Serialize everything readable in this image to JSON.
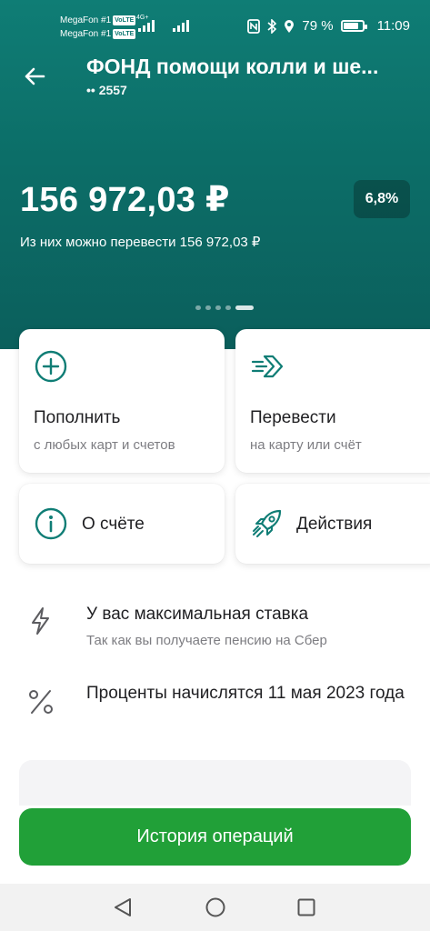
{
  "status_bar": {
    "sim1": "MegaFon #1",
    "sim2": "MegaFon #1",
    "volte": "VoLTE",
    "net_type": "4G+",
    "battery_percent": "79 %",
    "battery_level": 0.79,
    "time": "11:09"
  },
  "header": {
    "title": "ФОНД помощи колли и ше...",
    "account_mask": "•• 2557",
    "balance": "156 972,03 ₽",
    "rate_badge": "6,8%",
    "available_text": "Из них можно перевести 156 972,03 ₽",
    "pager": {
      "count": 5,
      "active_index": 4
    }
  },
  "actions": {
    "top_up": {
      "label": "Пополнить",
      "sub": "с любых карт и счетов",
      "icon": "plus-circle-icon"
    },
    "transfer": {
      "label": "Перевести",
      "sub": "на карту или счёт",
      "icon": "send-arrow-icon"
    },
    "about": {
      "label": "О счёте",
      "icon": "info-circle-icon"
    },
    "actions_menu": {
      "label": "Действия",
      "icon": "rocket-icon"
    }
  },
  "info_rows": {
    "rate": {
      "title": "У вас максимальная ставка",
      "subtitle": "Так как вы получаете пенсию на Сбер",
      "icon": "lightning-icon"
    },
    "interest": {
      "title": "Проценты начислятся 11 мая 2023 года",
      "icon": "percent-icon"
    }
  },
  "bottom": {
    "history_button": "История операций"
  },
  "colors": {
    "header_teal": "#0c6e68",
    "accent_green": "#21a038",
    "icon_teal": "#0f7d75"
  }
}
